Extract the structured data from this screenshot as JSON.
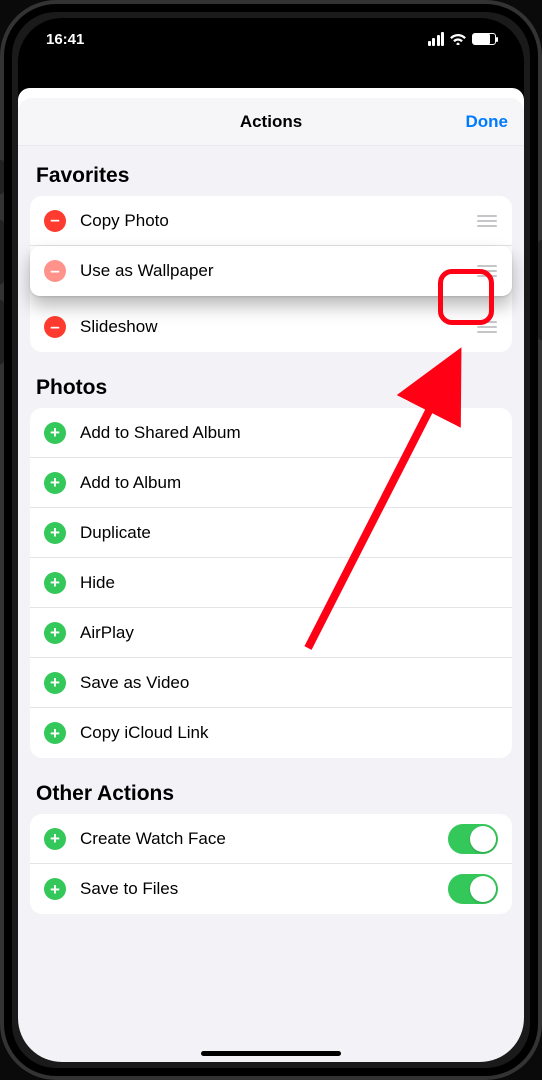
{
  "status": {
    "time": "16:41"
  },
  "sheet": {
    "title": "Actions",
    "done_label": "Done"
  },
  "sections": {
    "favorites": {
      "header": "Favorites",
      "rows": [
        {
          "label": "Copy Photo"
        },
        {
          "label": "Use as Wallpaper"
        },
        {
          "label": "Slideshow"
        }
      ]
    },
    "photos": {
      "header": "Photos",
      "rows": [
        {
          "label": "Add to Shared Album"
        },
        {
          "label": "Add to Album"
        },
        {
          "label": "Duplicate"
        },
        {
          "label": "Hide"
        },
        {
          "label": "AirPlay"
        },
        {
          "label": "Save as Video"
        },
        {
          "label": "Copy iCloud Link"
        }
      ]
    },
    "other": {
      "header": "Other Actions",
      "rows": [
        {
          "label": "Create Watch Face"
        },
        {
          "label": "Save to Files"
        }
      ]
    }
  }
}
